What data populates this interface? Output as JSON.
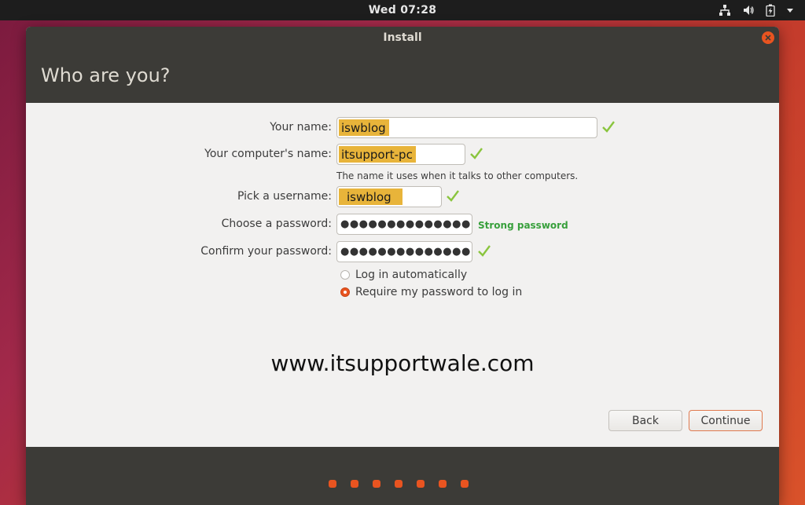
{
  "top_panel": {
    "clock": "Wed 07:28",
    "tray_icons": [
      "network-icon",
      "volume-icon",
      "battery-icon",
      "menu-arrow-icon"
    ]
  },
  "window": {
    "title": "Install",
    "header": "Who are you?"
  },
  "form": {
    "name_label": "Your name:",
    "name_value": "iswblog",
    "computer_label": "Your computer's name:",
    "computer_value": "itsupport-pc",
    "computer_hint": "The name it uses when it talks to other computers.",
    "username_label": "Pick a username:",
    "username_value": "iswblog",
    "password_label": "Choose a password:",
    "password_value": "●●●●●●●●●●●●●●",
    "password_strength": "Strong password",
    "confirm_label": "Confirm your password:",
    "confirm_value": "●●●●●●●●●●●●●●",
    "login_auto": "Log in automatically",
    "login_require": "Require my password to log in",
    "selected_login": "require"
  },
  "watermark": "www.itsupportwale.com",
  "buttons": {
    "back": "Back",
    "continue": "Continue"
  },
  "colors": {
    "accent": "#e95420",
    "check": "#8ac53e",
    "highlight": "#e8b43a",
    "header_bg": "#3c3b37"
  }
}
